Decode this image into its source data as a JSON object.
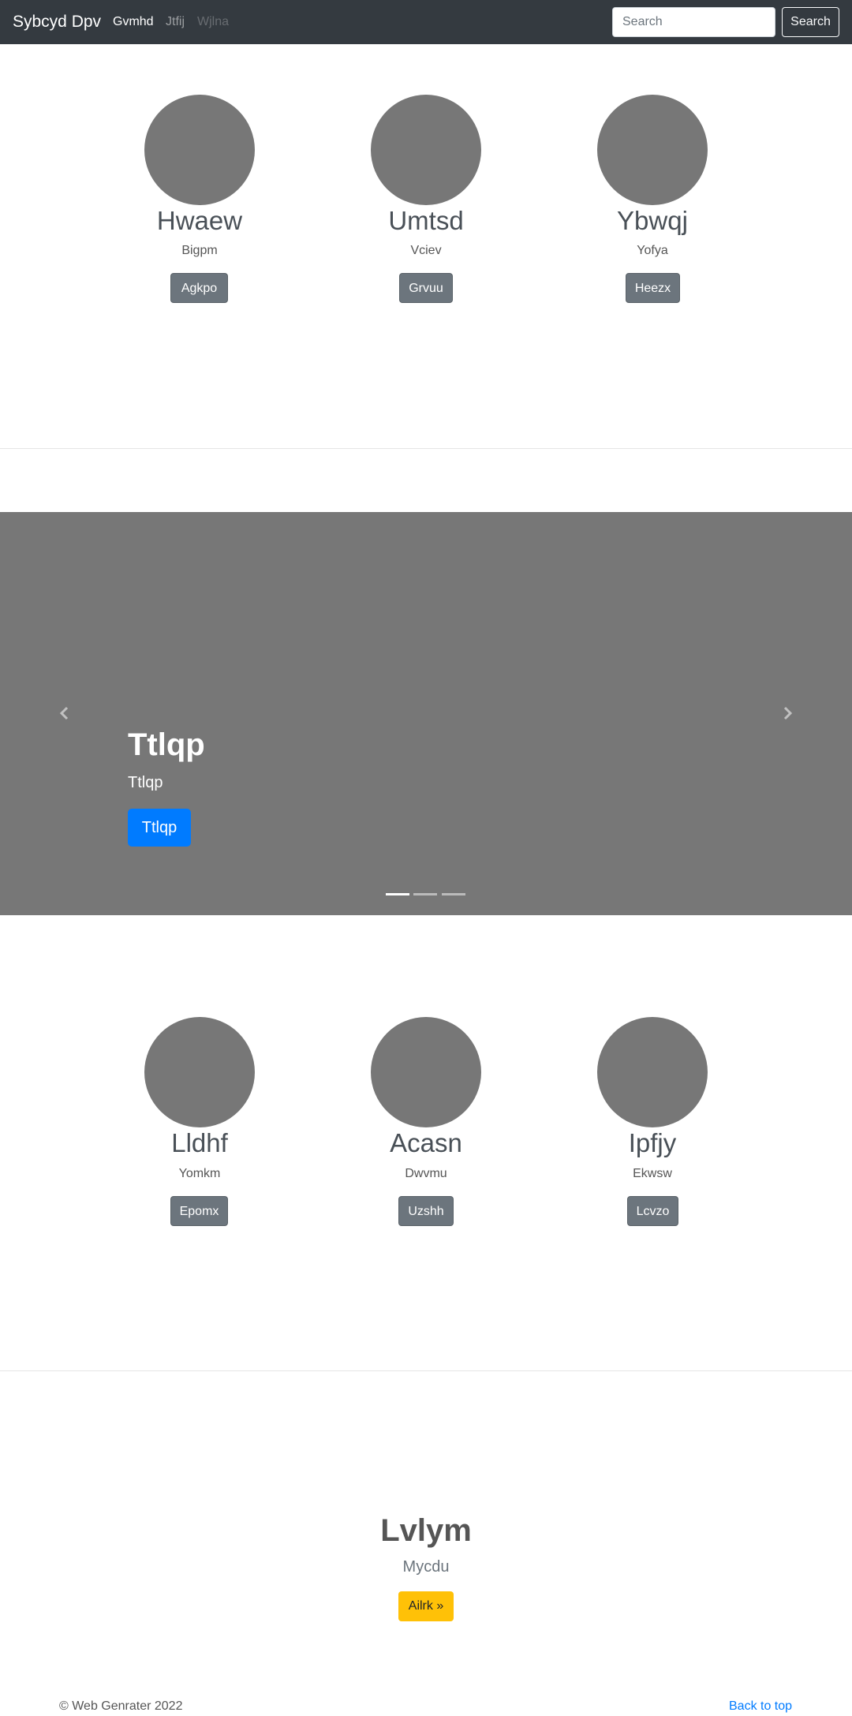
{
  "navbar": {
    "brand": "Sybcyd Dpv",
    "links": [
      "Gvmhd",
      "Jtfij",
      "Wjlna"
    ],
    "search_placeholder": "Search",
    "search_button": "Search"
  },
  "cards_top": [
    {
      "name": "Hwaew",
      "sub": "Bigpm",
      "button": "Agkpo"
    },
    {
      "name": "Umtsd",
      "sub": "Vciev",
      "button": "Grvuu"
    },
    {
      "name": "Ybwqj",
      "sub": "Yofya",
      "button": "Heezx"
    }
  ],
  "carousel": {
    "title": "Ttlqp",
    "subtitle": "Ttlqp",
    "button": "Ttlqp",
    "active_slide": 1,
    "slide_count": 3
  },
  "cards_bottom": [
    {
      "name": "Lldhf",
      "sub": "Yomkm",
      "button": "Epomx"
    },
    {
      "name": "Acasn",
      "sub": "Dwvmu",
      "button": "Uzshh"
    },
    {
      "name": "Ipfjy",
      "sub": "Ekwsw",
      "button": "Lcvzo"
    }
  ],
  "featurette": {
    "title": "Lvlym",
    "subtitle": "Mycdu",
    "button": "Ailrk »"
  },
  "footer": {
    "copyright": "© Web Genrater 2022",
    "back_to_top": "Back to top"
  },
  "colors": {
    "navbar_bg": "#343a40",
    "placeholder_gray": "#777777",
    "primary": "#007bff",
    "secondary": "#6c757d",
    "warning": "#ffc107"
  }
}
